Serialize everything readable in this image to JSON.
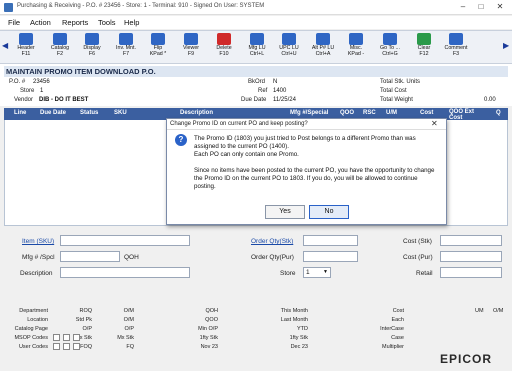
{
  "window": {
    "title": "Purchasing & Receiving - P.O. # 23456 - Store: 1 - Terminal: 910 - Signed On User: SYSTEM"
  },
  "menu": [
    "File",
    "Action",
    "Reports",
    "Tools",
    "Help"
  ],
  "toolbar": [
    {
      "name": "header",
      "line1": "Header",
      "line2": "F11",
      "icon": "header-icon",
      "color": "#2f66c4"
    },
    {
      "name": "catalog",
      "line1": "Catalog",
      "line2": "F2",
      "icon": "catalog-icon",
      "color": "#2f66c4"
    },
    {
      "name": "display",
      "line1": "Display",
      "line2": "F6",
      "icon": "display-icon",
      "color": "#2f66c4"
    },
    {
      "name": "inv-mnt",
      "line1": "Inv. Mnt.",
      "line2": "F7",
      "icon": "inventory-icon",
      "color": "#2f66c4"
    },
    {
      "name": "flip",
      "line1": "Flip",
      "line2": "KPad *",
      "icon": "flip-icon",
      "color": "#2f66c4"
    },
    {
      "name": "viewer",
      "line1": "Viewer",
      "line2": "F9",
      "icon": "viewer-icon",
      "color": "#2f66c4"
    },
    {
      "name": "delete",
      "line1": "Delete",
      "line2": "F10",
      "icon": "delete-icon",
      "color": "#d02a2a"
    },
    {
      "name": "mfg-lu",
      "line1": "Mfg LU",
      "line2": "Ctrl+L",
      "icon": "barcode-icon",
      "color": "#2f66c4"
    },
    {
      "name": "upc-lu",
      "line1": "UPC LU",
      "line2": "Ctrl+U",
      "icon": "barcode-icon",
      "color": "#2f66c4"
    },
    {
      "name": "alt-lu",
      "line1": "Alt P# LU",
      "line2": "Ctrl+A",
      "icon": "barcode-icon",
      "color": "#2f66c4"
    },
    {
      "name": "misc",
      "line1": "Misc.",
      "line2": "KPad -",
      "icon": "misc-icon",
      "color": "#2f66c4"
    },
    {
      "name": "goto",
      "line1": "Go To ...",
      "line2": "Ctrl+G",
      "icon": "goto-icon",
      "color": "#2f66c4"
    },
    {
      "name": "clear",
      "line1": "Clear",
      "line2": "F12",
      "icon": "clear-icon",
      "color": "#2a9a4a"
    },
    {
      "name": "comment",
      "line1": "Comment",
      "line2": "F3",
      "icon": "comment-icon",
      "color": "#2f66c4"
    }
  ],
  "header": {
    "title": "MAINTAIN PROMO ITEM DOWNLOAD P.O.",
    "po_label": "P.O. #",
    "po_value": "23456",
    "store_label": "Store",
    "store_value": "1",
    "vendor_label": "Vendor",
    "vendor_value": "DIB - DO IT BEST",
    "bkord_label": "BkOrd",
    "bkord_value": "N",
    "ref_label": "Ref",
    "ref_value": "1400",
    "due_label": "Due Date",
    "due_value": "11/25/24",
    "total_stk": "Total Stk. Units",
    "total_cost": "Total Cost",
    "total_weight": "Total Weight",
    "total_weight_value": "0.00"
  },
  "grid": {
    "columns": [
      "Line",
      "Due Date",
      "Status",
      "SKU",
      "Description",
      "Mfg #/Special",
      "QOO",
      "RSC",
      "U/M",
      "Cost",
      "QOO Ext Cost",
      "Q"
    ]
  },
  "lower": {
    "item_label": "Item (SKU)",
    "mfg_label": "Mfg # /Spcl",
    "qoh_label": "QOH",
    "desc_label": "Description",
    "order_qty_stk_label": "Order Qty(Stk)",
    "order_qty_pur_label": "Order Qty(Pur)",
    "store_label": "Store",
    "store_value": "1",
    "cost_stk_label": "Cost (Stk)",
    "cost_pur_label": "Cost (Pur)",
    "retail_label": "Retail"
  },
  "bottom": {
    "col1": [
      "Department",
      "Location",
      "Catalog Page",
      "MSOP Codes",
      "User Codes"
    ],
    "col2": [
      "ROQ",
      "Std Pk",
      "O/P",
      "Mx Stk",
      "FOQ"
    ],
    "col3": [
      "O/M",
      "O/M",
      "O/P",
      "Mx Stk",
      "FQ"
    ],
    "col4": [
      "QOH",
      "QOO",
      "Min O/P",
      "1fty Stk",
      "Nov 23"
    ],
    "col5": [
      "This Month",
      "Last Month",
      "YTD",
      "1fty Stk",
      "Dec 23"
    ],
    "col6": [
      "Cost",
      "Each",
      "InterCase",
      "Case",
      "Multiplier"
    ],
    "um": "UM",
    "cost_head": "O/M"
  },
  "logo": "EPICOR",
  "dialog": {
    "title": "Change Promo ID on current PO and keep posting?",
    "p1": "The Promo ID (1803) you just tried to Post belongs to a different Promo than was assigned to the current PO (1400).",
    "p1b": "Each PO can only contain one Promo.",
    "p2": "Since no items have been posted to the current PO, you have the opportunity to change the Promo ID on the current PO to 1803.  If you do, you will be allowed to continue posting.",
    "yes": "Yes",
    "no": "No"
  }
}
